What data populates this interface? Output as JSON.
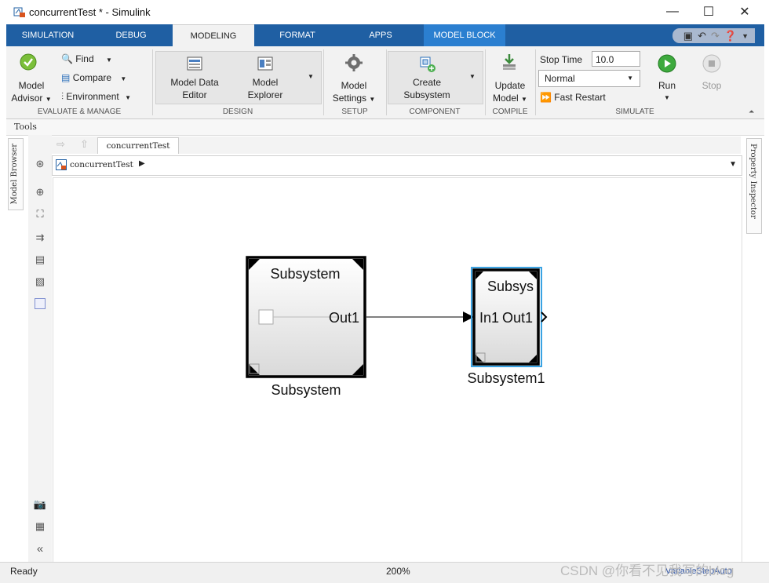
{
  "window": {
    "title": "concurrentTest * - Simulink",
    "minimize": "—",
    "maximize": "☐",
    "close": "✕"
  },
  "tabs": [
    {
      "label": "SIMULATION"
    },
    {
      "label": "DEBUG"
    },
    {
      "label": "MODELING"
    },
    {
      "label": "FORMAT"
    },
    {
      "label": "APPS"
    },
    {
      "label": "MODEL BLOCK"
    }
  ],
  "ribbon": {
    "evaluate": {
      "advisor_line1": "Model",
      "advisor_line2": "Advisor",
      "find": "Find",
      "compare": "Compare",
      "environment": "Environment",
      "group": "EVALUATE & MANAGE"
    },
    "design": {
      "data_editor_line1": "Model Data",
      "data_editor_line2": "Editor",
      "explorer_line1": "Model",
      "explorer_line2": "Explorer",
      "group": "DESIGN"
    },
    "setup": {
      "settings_line1": "Model",
      "settings_line2": "Settings",
      "group": "SETUP"
    },
    "component": {
      "create_line1": "Create",
      "create_line2": "Subsystem",
      "group": "COMPONENT"
    },
    "compile": {
      "update_line1": "Update",
      "update_line2": "Model",
      "group": "COMPILE"
    },
    "simulate": {
      "stop_time_label": "Stop Time",
      "stop_time_value": "10.0",
      "mode": "Normal",
      "fast_restart": "Fast Restart",
      "run": "Run",
      "stop": "Stop",
      "group": "SIMULATE"
    }
  },
  "tools_label": "Tools",
  "side": {
    "model_browser": "Model Browser",
    "property_inspector": "Property Inspector"
  },
  "editor": {
    "model_tab": "concurrentTest",
    "breadcrumb": "concurrentTest"
  },
  "blocks": {
    "subsystem": {
      "title": "Subsystem",
      "port_out": "Out1",
      "name": "Subsystem"
    },
    "subsystem1": {
      "title": "Subsys",
      "port_in": "In1",
      "port_out": "Out1",
      "name": "Subsystem1"
    }
  },
  "status": {
    "left": "Ready",
    "zoom": "200%",
    "solver": "VariableStepAuto",
    "watermark": "CSDN @你看不见我写的blog"
  },
  "colors": {
    "ribbon_tab_bg": "#1f5fa3",
    "model_block_tab": "#2b7fd0",
    "selection": "#3aa3e3"
  }
}
